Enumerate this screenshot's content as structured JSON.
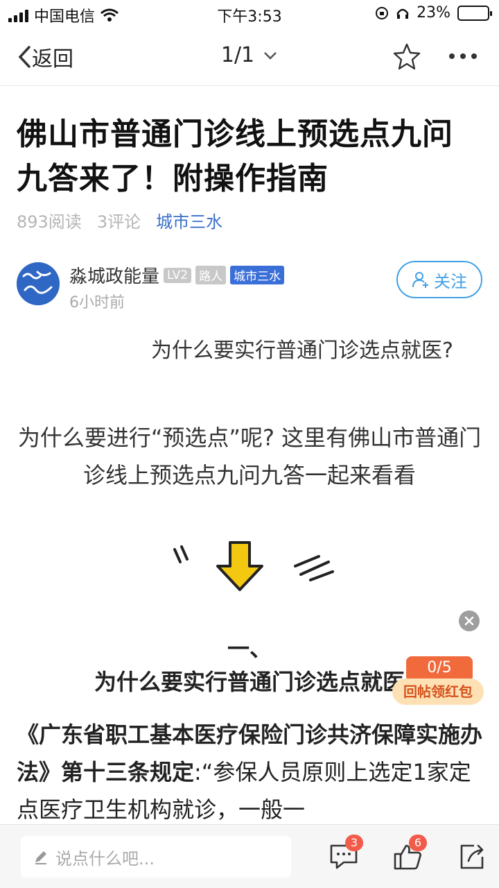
{
  "status_bar": {
    "carrier": "中国电信",
    "time": "下午3:53",
    "battery": "23%"
  },
  "nav": {
    "back_label": "返回",
    "page_counter": "1/1"
  },
  "article": {
    "title": "佛山市普通门诊线上预选点九问九答来了！附操作指南",
    "reads": "893阅读",
    "comments": "3评论",
    "topic": "城市三水"
  },
  "author": {
    "name": "淼城政能量",
    "avatar_text": "淼城政能量",
    "badges": [
      "LV2",
      "路人",
      "城市三水"
    ],
    "time": "6小时前",
    "follow_label": "关注"
  },
  "body": {
    "sub_question": "为什么要实行普通门诊选点就医?",
    "intro": "为什么要进行“预选点”呢? 这里有佛山市普通门诊线上预选点九问九答一起来看看",
    "section_number": "一、",
    "section_heading": "为什么要实行普通门诊选点就医",
    "paragraph_bold": "《广东省职工基本医疗保险门诊共济保障实施办法》第十三条规定",
    "paragraph_rest": ":“参保人员原则上选定1家定点医疗卫生机构就诊，一般一"
  },
  "redpacket": {
    "count": "0/5",
    "label": "回帖领红包"
  },
  "bottom_bar": {
    "comment_placeholder": "说点什么吧...",
    "comment_count": "3",
    "like_count": "6"
  },
  "colors": {
    "accent_blue": "#3fa0e6",
    "topic_blue": "#3b6ec9",
    "redpacket_orange": "#f06a3c",
    "badge_red": "#f25b4a"
  }
}
